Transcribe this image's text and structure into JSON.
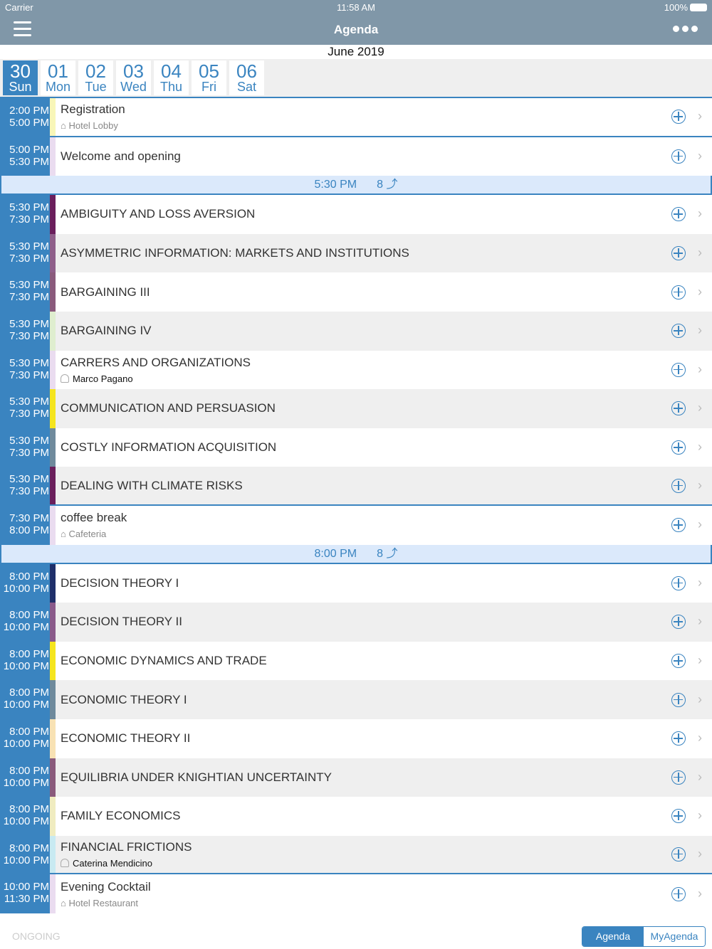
{
  "status": {
    "carrier": "Carrier",
    "time": "11:58 AM",
    "battery": "100%"
  },
  "header": {
    "title": "Agenda"
  },
  "month": "June 2019",
  "days": [
    {
      "n": "30",
      "w": "Sun",
      "selected": true
    },
    {
      "n": "01",
      "w": "Mon"
    },
    {
      "n": "02",
      "w": "Tue"
    },
    {
      "n": "03",
      "w": "Wed"
    },
    {
      "n": "04",
      "w": "Thu"
    },
    {
      "n": "05",
      "w": "Fri"
    },
    {
      "n": "06",
      "w": "Sat"
    }
  ],
  "items": [
    {
      "start": "2:00 PM",
      "end": "5:00 PM",
      "title": "Registration",
      "sub": "⌂ Hotel Lobby",
      "color": "#f8f6b8",
      "last": true
    },
    {
      "start": "5:00 PM",
      "end": "5:30 PM",
      "title": "Welcome and opening",
      "color": "#eadcf0"
    },
    {
      "group": true,
      "time": "5:30 PM",
      "count": "8 ⤴"
    },
    {
      "start": "5:30 PM",
      "end": "7:30 PM",
      "title": "AMBIGUITY AND LOSS AVERSION",
      "color": "#6b1f5c"
    },
    {
      "start": "5:30 PM",
      "end": "7:30 PM",
      "title": "ASYMMETRIC INFORMATION: MARKETS AND INSTITUTIONS",
      "color": "#8f5f8a",
      "alt": true
    },
    {
      "start": "5:30 PM",
      "end": "7:30 PM",
      "title": "BARGAINING III",
      "color": "#8a5a7c"
    },
    {
      "start": "5:30 PM",
      "end": "7:30 PM",
      "title": "BARGAINING IV",
      "color": "#dfeecf",
      "alt": true
    },
    {
      "start": "5:30 PM",
      "end": "7:30 PM",
      "title": "CARRERS AND ORGANIZATIONS",
      "sub": "Marco Pagano",
      "person": true,
      "color": "#eadcf0"
    },
    {
      "start": "5:30 PM",
      "end": "7:30 PM",
      "title": "COMMUNICATION AND PERSUASION",
      "color": "#f5e51e",
      "alt": true
    },
    {
      "start": "5:30 PM",
      "end": "7:30 PM",
      "title": "COSTLY INFORMATION ACQUISITION",
      "color": "#6f8a9c"
    },
    {
      "start": "5:30 PM",
      "end": "7:30 PM",
      "title": "DEALING WITH CLIMATE RISKS",
      "color": "#6b1f5c",
      "alt": true,
      "last": true
    },
    {
      "start": "7:30 PM",
      "end": "8:00 PM",
      "title": "coffee break",
      "sub": "⌂ Cafeteria",
      "color": "#eadcf0"
    },
    {
      "group": true,
      "time": "8:00 PM",
      "count": "8 ⤴"
    },
    {
      "start": "8:00 PM",
      "end": "10:00 PM",
      "title": "DECISION THEORY I",
      "color": "#1f2f6a"
    },
    {
      "start": "8:00 PM",
      "end": "10:00 PM",
      "title": "DECISION THEORY II",
      "color": "#8a5a8a",
      "alt": true
    },
    {
      "start": "8:00 PM",
      "end": "10:00 PM",
      "title": "ECONOMIC DYNAMICS AND TRADE",
      "color": "#f5e51e"
    },
    {
      "start": "8:00 PM",
      "end": "10:00 PM",
      "title": "ECONOMIC THEORY I",
      "color": "#6f8a9c",
      "alt": true
    },
    {
      "start": "8:00 PM",
      "end": "10:00 PM",
      "title": "ECONOMIC THEORY II",
      "color": "#f8e2b4"
    },
    {
      "start": "8:00 PM",
      "end": "10:00 PM",
      "title": "EQUILIBRIA UNDER KNIGHTIAN UNCERTAINTY",
      "color": "#8a5a7c",
      "alt": true
    },
    {
      "start": "8:00 PM",
      "end": "10:00 PM",
      "title": "FAMILY ECONOMICS",
      "color": "#f0ecc0"
    },
    {
      "start": "8:00 PM",
      "end": "10:00 PM",
      "title": "FINANCIAL FRICTIONS",
      "sub": "Caterina Mendicino",
      "person": true,
      "color": "#c8eaf2",
      "alt": true,
      "last": true
    },
    {
      "start": "10:00 PM",
      "end": "11:30 PM",
      "title": "Evening Cocktail",
      "sub": "⌂ Hotel Restaurant",
      "color": "#eadcf0"
    }
  ],
  "footer": {
    "ongoing": "ONGOING",
    "tabs": [
      "Agenda",
      "MyAgenda"
    ]
  }
}
